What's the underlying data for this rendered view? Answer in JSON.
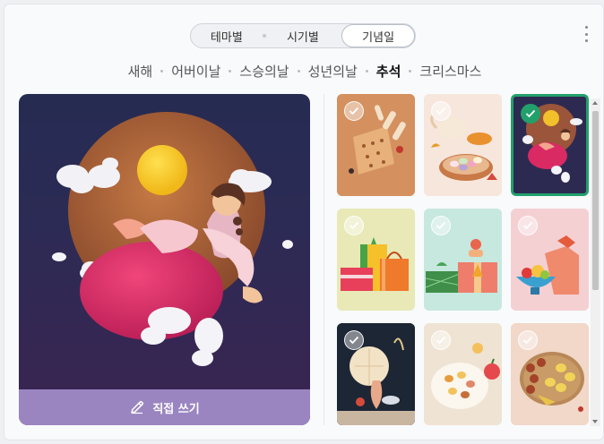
{
  "category_tabs": [
    {
      "label": "테마별",
      "active": false
    },
    {
      "label": "시기별",
      "active": false
    },
    {
      "label": "기념일",
      "active": true
    }
  ],
  "subtabs": [
    {
      "label": "새해",
      "active": false
    },
    {
      "label": "어버이날",
      "active": false
    },
    {
      "label": "스승의날",
      "active": false
    },
    {
      "label": "성년의날",
      "active": false
    },
    {
      "label": "추석",
      "active": true
    },
    {
      "label": "크리스마스",
      "active": false
    }
  ],
  "preview": {
    "action_label": "직접 쓰기",
    "icon": "pencil-icon"
  },
  "thumbnails": [
    {
      "name": "yut-game-thumb",
      "selected": false
    },
    {
      "name": "teapot-songpyeon-thumb",
      "selected": false
    },
    {
      "name": "moon-girl-thumb",
      "selected": true
    },
    {
      "name": "gift-boxes-thumb",
      "selected": false
    },
    {
      "name": "gift-set-thumb",
      "selected": false
    },
    {
      "name": "fruit-bowl-thumb",
      "selected": false
    },
    {
      "name": "moon-vase-thumb",
      "selected": false
    },
    {
      "name": "songpyeon-plate-thumb",
      "selected": false
    },
    {
      "name": "jeon-platter-thumb",
      "selected": false
    }
  ],
  "colors": {
    "accent_selected": "#22a06b",
    "preview_bar": "#9a85c0"
  }
}
